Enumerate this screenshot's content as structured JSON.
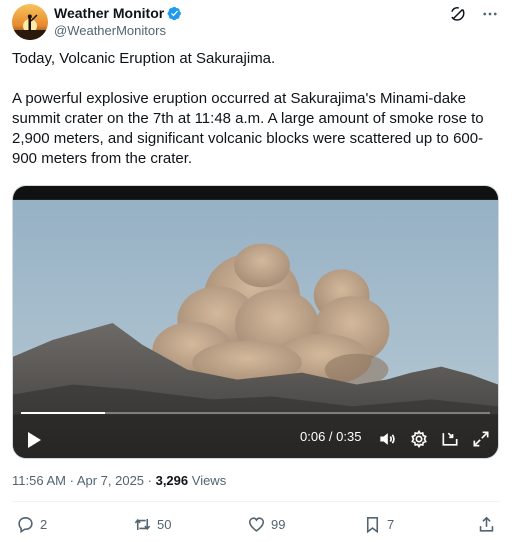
{
  "author": {
    "display_name": "Weather Monitor",
    "handle": "@WeatherMonitors",
    "verified": true,
    "avatar_icon": "sunset-figure-avatar"
  },
  "header_actions": [
    {
      "icon": "grok-icon"
    },
    {
      "icon": "more-icon"
    }
  ],
  "text": {
    "line1": "Today, Volcanic Eruption at Sakurajima.",
    "line2": "A powerful  explosive eruption occurred at Sakurajima's Minami-dake summit crater on the 7th at 11:48 a.m. A large amount of smoke rose to 2,900 meters, and significant volcanic blocks were scattered up to 600-900 meters from the crater."
  },
  "video": {
    "current_time": "0:06",
    "separator": " / ",
    "duration": "0:35",
    "progress_fraction": 0.18,
    "controls": [
      "play-icon",
      "volume-icon",
      "settings-icon",
      "pip-icon",
      "fullscreen-icon"
    ]
  },
  "meta": {
    "time": "11:56 AM",
    "dot": " · ",
    "date": "Apr 7, 2025",
    "views_count": "3,296",
    "views_label": " Views"
  },
  "actions": {
    "replies": "2",
    "reposts": "50",
    "likes": "99",
    "bookmarks": "7"
  },
  "colors": {
    "verified_blue": "#1d9bf0",
    "secondary_text": "#536471",
    "primary_text": "#0f1419"
  }
}
